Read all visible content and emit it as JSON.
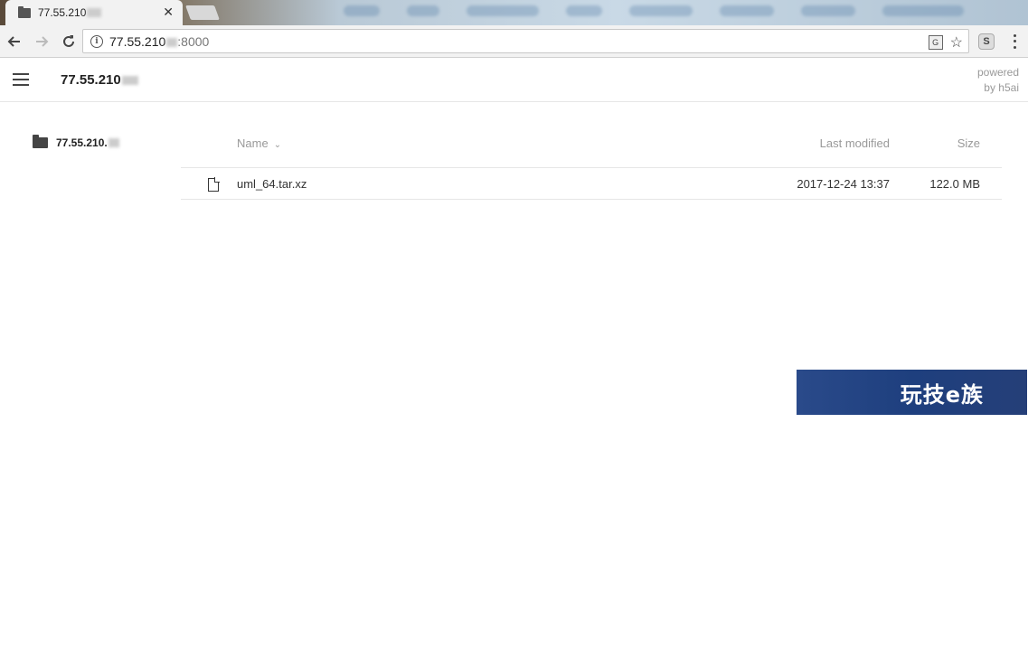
{
  "browser": {
    "tab": {
      "title": "77.55.210",
      "close": "✕"
    },
    "omnibox": {
      "url_host": "77.55.210",
      "url_port": ":8000"
    },
    "extension_label": "S"
  },
  "h5ai": {
    "header_title": "77.55.210",
    "powered_line1": "powered",
    "powered_line2": "by h5ai",
    "tree_root": "77.55.210.",
    "columns": {
      "name": "Name",
      "last_modified": "Last modified",
      "size": "Size"
    },
    "files": [
      {
        "name": "uml_64.tar.xz",
        "modified": "2017-12-24 13:37",
        "size": "122.0 MB"
      }
    ]
  },
  "watermark": {
    "text": "玩技e族"
  },
  "icons": [
    "folder-icon",
    "close-icon",
    "back-icon",
    "forward-icon",
    "reload-icon",
    "info-icon",
    "translate-icon",
    "star-icon",
    "menu-icon",
    "hamburger-icon",
    "file-icon",
    "chevron-down-icon"
  ]
}
